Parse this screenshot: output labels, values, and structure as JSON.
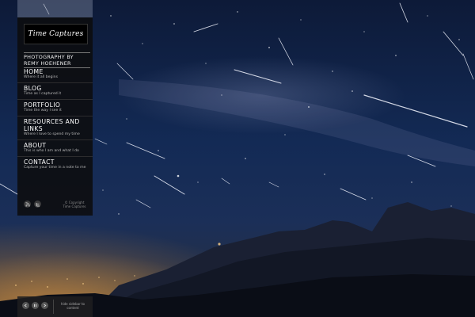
{
  "brand": {
    "logo_text": "Time Captures",
    "tagline_line1": "PHOTOGRAPHY BY",
    "tagline_line2": "REMY HOEHENER"
  },
  "nav": [
    {
      "title": "HOME",
      "subtitle": "Where it all begins"
    },
    {
      "title": "BLOG",
      "subtitle": "Time as I captured it"
    },
    {
      "title": "PORTFOLIO",
      "subtitle": "Time the way I see it"
    },
    {
      "title": "RESOURCES AND LINKS",
      "subtitle": "Where I love to spend my time"
    },
    {
      "title": "ABOUT",
      "subtitle": "This is who I am and what I do"
    },
    {
      "title": "CONTACT",
      "subtitle": "Capture your time in a note to me"
    }
  ],
  "social": {
    "first_icon": "rss-icon",
    "second_icon": "twitter-icon"
  },
  "footer": {
    "copyright_line1": "© Copyright",
    "copyright_line2": "Time Captures"
  },
  "player": {
    "hint_line1": "hide sidebar to",
    "hint_line2": "content"
  },
  "colors": {
    "sidebar_bg": "#0c0c0e",
    "sky_top": "#0d1a38",
    "city_glow": "#f0aa46"
  }
}
